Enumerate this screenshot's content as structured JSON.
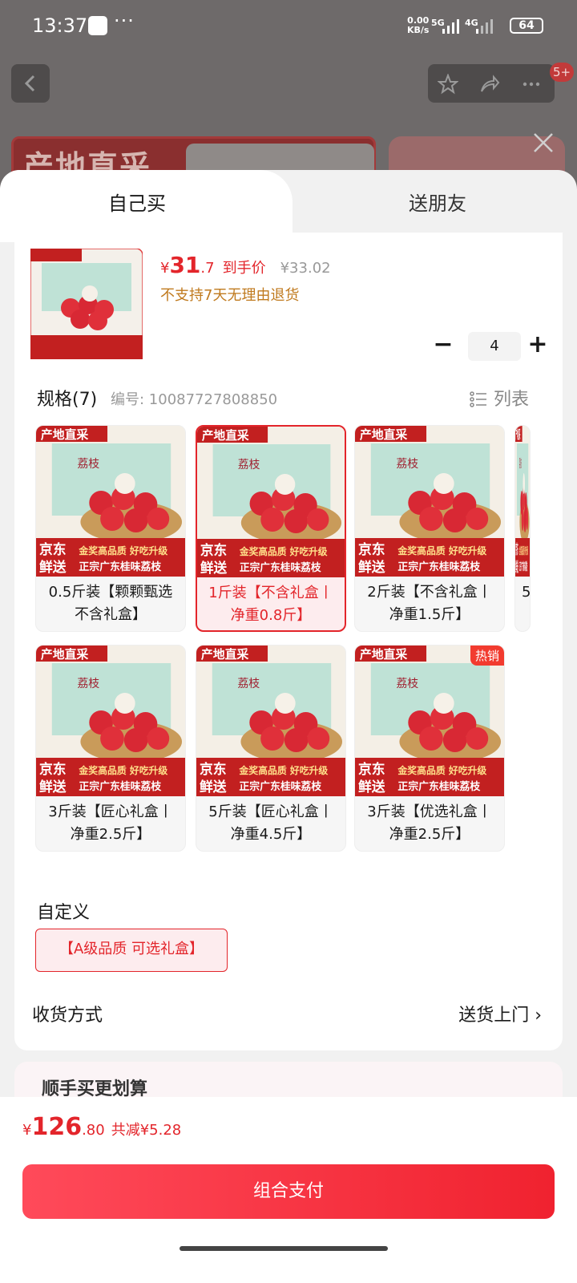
{
  "status_bar": {
    "time": "13:37",
    "speed": "0.00",
    "speed_unit": "KB/s",
    "net1": "5G",
    "net2": "4G",
    "battery": "64"
  },
  "header": {
    "more_badge": "5+"
  },
  "background": {
    "banner_text": "产地直采"
  },
  "tabs": {
    "self": "自己买",
    "friend": "送朋友"
  },
  "product": {
    "price_symbol": "¥",
    "price_int": "31",
    "price_dec": ".7",
    "price_label": "到手价",
    "original_price": "¥33.02",
    "return_note": "不支持7天无理由退货",
    "quantity": "4",
    "minus": "−",
    "plus": "+"
  },
  "spec": {
    "title": "规格(7)",
    "code": "编号: 10087727808850",
    "list_label": "列表",
    "options": [
      {
        "label": "0.5斤装【颗颗甄选 不含礼盒】"
      },
      {
        "label": "1斤装【不含礼盒丨净重0.8斤】",
        "selected": true
      },
      {
        "label": "2斤装【不含礼盒丨净重1.5斤】"
      },
      {
        "label": "5"
      },
      {
        "label": "3斤装【匠心礼盒丨净重2.5斤】"
      },
      {
        "label": "5斤装【匠心礼盒丨净重4.5斤】"
      },
      {
        "label": "3斤装【优选礼盒丨净重2.5斤】",
        "badge": "热销"
      }
    ],
    "img_banner": "产地直采",
    "img_brand": "京东鲜送",
    "img_line1": "金奖高品质 好吃升级",
    "img_line2": "正宗广东桂味荔枝",
    "img_box": "荔枝"
  },
  "custom": {
    "title": "自定义",
    "chip": "【A级品质 可选礼盒】"
  },
  "shipping": {
    "label": "收货方式",
    "value": "送货上门 ›"
  },
  "promo": {
    "title": "顺手买更划算"
  },
  "footer": {
    "symbol": "¥",
    "total_int": "126",
    "total_dec": ".80",
    "saving": "共减¥5.28",
    "pay_label": "组合支付"
  },
  "colors": {
    "accent": "#e3252b",
    "warn": "#c07a1e"
  }
}
